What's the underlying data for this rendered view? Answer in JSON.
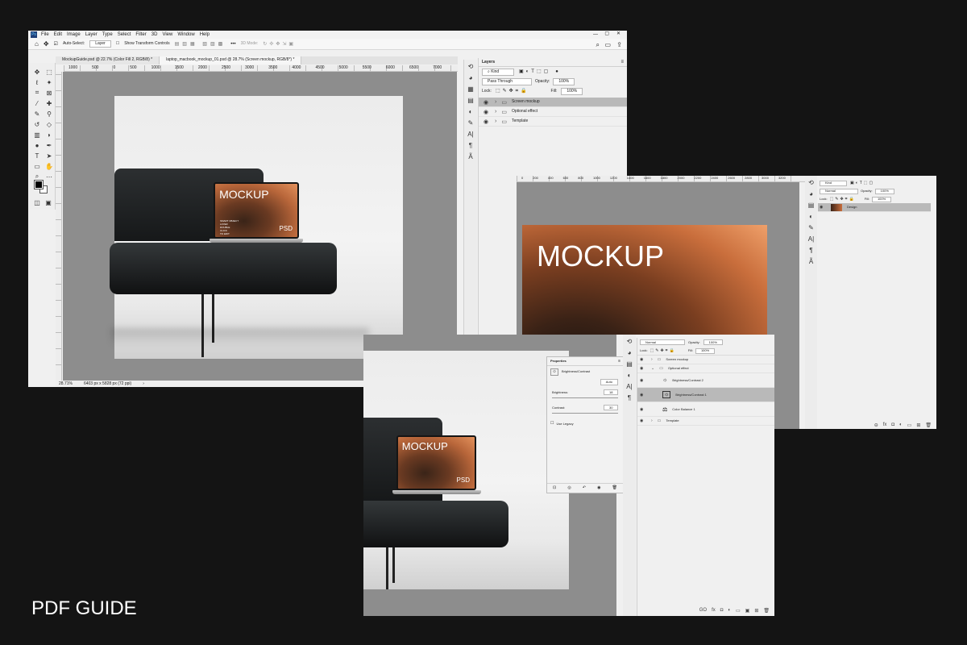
{
  "colors": {
    "background": "#141414",
    "workspace_gray": "#8d8d8d",
    "layer_selected": "#b9b9b9",
    "mock_orange": "#c96e3c"
  },
  "window1": {
    "app_icon": "Ps",
    "menu": [
      "File",
      "Edit",
      "Image",
      "Layer",
      "Type",
      "Select",
      "Filter",
      "3D",
      "View",
      "Window",
      "Help"
    ],
    "options": {
      "home_icon": "home-icon",
      "move_icon": "move-icon",
      "auto_select": "Auto-Select:",
      "layer_dropdown": "Layer",
      "show_transform": "Show Transform Controls",
      "more": "•••",
      "mode_3d": "3D Mode:"
    },
    "tabs": [
      {
        "label": "MockupGuide.psd @ 22.7% (Color Fill 2, RGB/8) *"
      },
      {
        "label": "laptop_macbook_mockup_01.psd @ 28.7% (Screen mockup, RGB/8*) *"
      }
    ],
    "ruler_numbers": [
      "1000",
      "500",
      "0",
      "500",
      "1000",
      "1500",
      "2000",
      "2500",
      "3000",
      "3500",
      "4000",
      "4500",
      "5000",
      "5500",
      "6000",
      "6500",
      "7000"
    ],
    "status": {
      "zoom": "28.71%",
      "doc": "6403 px x 5828 px (72 ppi)",
      "arrow": "›"
    },
    "screen": {
      "title": "MOCKUP",
      "small_lines": [
        "SMART OBJECT",
        "LAYER",
        "DOUBLE",
        "CLICK",
        "TO EDIT"
      ],
      "tag": "PSD"
    },
    "layers": {
      "tab": "Layers",
      "kind": "Kind",
      "blend": "Pass Through",
      "opacity_label": "Opacity:",
      "opacity": "100%",
      "lock_label": "Lock:",
      "fill_label": "Fill:",
      "fill": "100%",
      "rows": [
        {
          "name": "Screen mockup",
          "selected": true
        },
        {
          "name": "Optional effect",
          "selected": false
        },
        {
          "name": "Template",
          "selected": false
        }
      ]
    }
  },
  "window2": {
    "ruler_numbers": [
      "0",
      "200",
      "400",
      "600",
      "800",
      "1000",
      "1200",
      "1400",
      "1600",
      "1800",
      "2000",
      "2200",
      "2400",
      "2600",
      "2800",
      "3000",
      "3200"
    ],
    "mock_title": "MOCKUP",
    "layers": {
      "kind": "Kind",
      "blend": "Normal",
      "opacity_label": "Opacity:",
      "opacity": "100%",
      "lock_label": "Lock:",
      "fill_label": "Fill:",
      "fill": "100%",
      "row": "Design"
    }
  },
  "window3": {
    "screen": {
      "title": "MOCKUP",
      "tag": "PSD"
    },
    "properties": {
      "title": "Properties",
      "adj": "Brightness/Contrast",
      "auto": "Auto",
      "brightness_label": "Brightness:",
      "brightness": "18",
      "contrast_label": "Contrast:",
      "contrast": "30",
      "legacy": "Use Legacy"
    },
    "layers": {
      "blend": "Normal",
      "opacity_label": "Opacity:",
      "opacity": "100%",
      "lock_label": "Lock:",
      "fill_label": "Fill:",
      "fill": "100%",
      "rows": [
        {
          "name": "Screen mockup",
          "indent": 0,
          "selected": false
        },
        {
          "name": "Optional effect",
          "indent": 0,
          "selected": false
        },
        {
          "name": "Brightness/Contrast 2",
          "indent": 1,
          "selected": false
        },
        {
          "name": "Brightness/Contrast 1",
          "indent": 1,
          "selected": true
        },
        {
          "name": "Color Balance 1",
          "indent": 1,
          "selected": false
        },
        {
          "name": "Template",
          "indent": 0,
          "selected": false
        }
      ],
      "footer": [
        "GO",
        "fx",
        "◘",
        "◐",
        "▭",
        "▣",
        "⊞",
        "🗑"
      ]
    }
  },
  "caption": "PDF GUIDE"
}
